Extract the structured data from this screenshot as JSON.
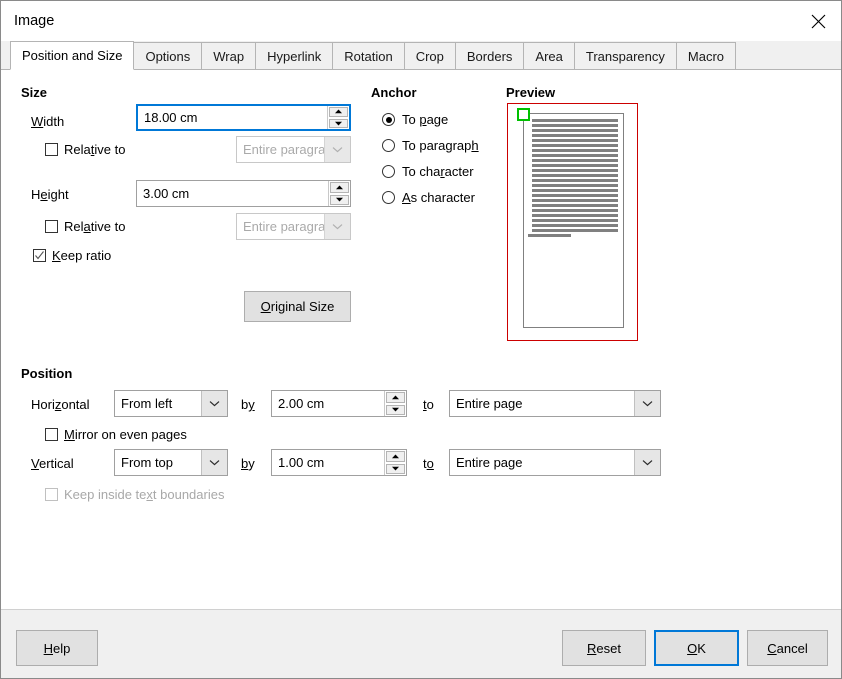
{
  "window": {
    "title": "Image",
    "close_icon": "close-icon"
  },
  "tabs": [
    {
      "label": "Position and Size",
      "active": true
    },
    {
      "label": "Options",
      "active": false
    },
    {
      "label": "Wrap",
      "active": false
    },
    {
      "label": "Hyperlink",
      "active": false
    },
    {
      "label": "Rotation",
      "active": false
    },
    {
      "label": "Crop",
      "active": false
    },
    {
      "label": "Borders",
      "active": false
    },
    {
      "label": "Area",
      "active": false
    },
    {
      "label": "Transparency",
      "active": false
    },
    {
      "label": "Macro",
      "active": false
    }
  ],
  "size": {
    "group_label": "Size",
    "width_label": "Width",
    "width_value": "18.00 cm",
    "width_relative_label": "Relative to",
    "width_relative_checked": false,
    "width_relative_value": "Entire paragraph area",
    "height_label": "Height",
    "height_value": "3.00 cm",
    "height_relative_label": "Relative to",
    "height_relative_checked": false,
    "height_relative_value": "Entire paragraph area",
    "keep_ratio_label": "Keep ratio",
    "keep_ratio_checked": true,
    "original_size_label": "Original Size"
  },
  "anchor": {
    "group_label": "Anchor",
    "options": [
      {
        "label": "To page",
        "selected": true
      },
      {
        "label": "To paragraph",
        "selected": false
      },
      {
        "label": "To character",
        "selected": false
      },
      {
        "label": "As character",
        "selected": false
      }
    ]
  },
  "preview": {
    "group_label": "Preview",
    "border_color": "#cc0000",
    "page_border_color": "#808080",
    "text_line_color": "#808080",
    "anchor_marker_color": "#00c000",
    "full_line_count": 23,
    "short_line_present": true
  },
  "position": {
    "group_label": "Position",
    "horizontal_label": "Horizontal",
    "horizontal_value": "From left",
    "horizontal_by_label": "by",
    "horizontal_by_value": "2.00 cm",
    "horizontal_to_label": "to",
    "horizontal_to_value": "Entire page",
    "mirror_label": "Mirror on even pages",
    "mirror_checked": false,
    "vertical_label": "Vertical",
    "vertical_value": "From top",
    "vertical_by_label": "by",
    "vertical_by_value": "1.00 cm",
    "vertical_to_label": "to",
    "vertical_to_value": "Entire page",
    "keep_inside_label": "Keep inside text boundaries",
    "keep_inside_checked": false,
    "keep_inside_disabled": true
  },
  "buttons": {
    "help": "Help",
    "reset": "Reset",
    "ok": "OK",
    "cancel": "Cancel"
  },
  "colors": {
    "focus_blue": "#0078d7",
    "dialog_bg": "#f0f0f0",
    "panel_bg": "#ffffff"
  }
}
